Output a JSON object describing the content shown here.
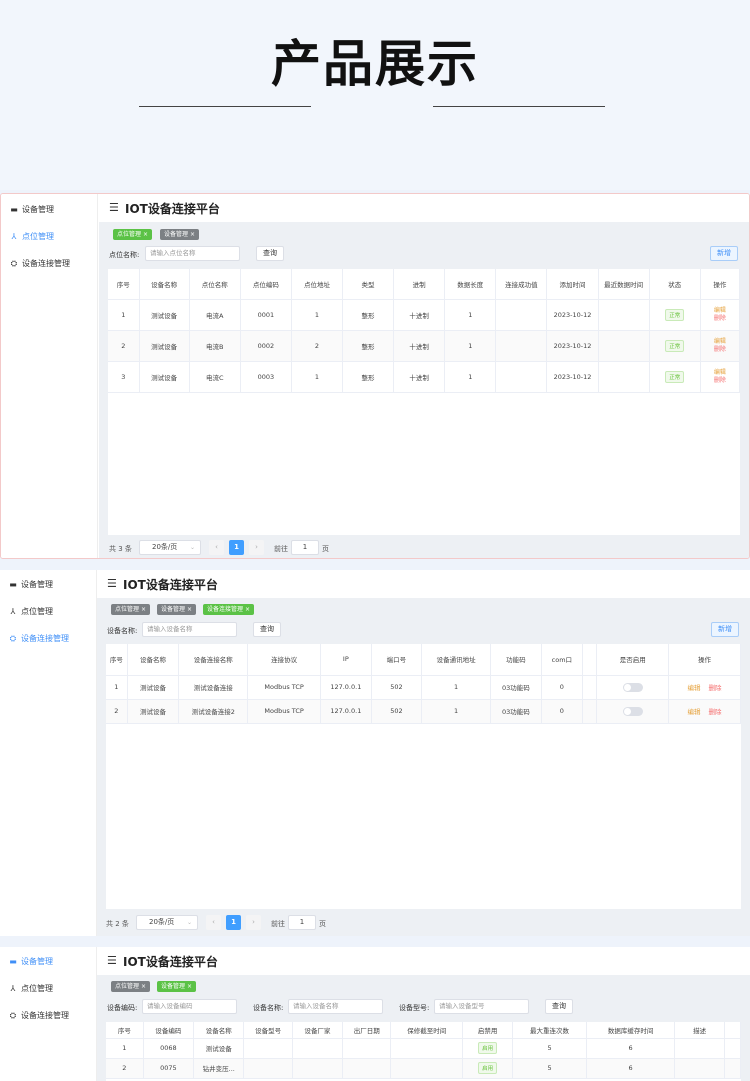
{
  "hero": {
    "title": "产品展示"
  },
  "app": {
    "title": "IOT设备连接平台"
  },
  "sidebar": {
    "items": [
      "设备管理",
      "点位管理",
      "设备连接管理"
    ]
  },
  "tags": {
    "point": "点位管理",
    "device": "设备管理",
    "connection": "设备连接管理",
    "close": "×"
  },
  "buttons": {
    "query": "查询",
    "add": "新增"
  },
  "pager": {
    "page_size": "20条/页",
    "goto": "前往",
    "page_unit": "页",
    "current_page": "1",
    "prev": "‹",
    "next": "›",
    "size_arrow": "⌄"
  },
  "panel1": {
    "search_label": "点位名称:",
    "search_placeholder": "请输入点位名称",
    "headers": [
      "序号",
      "设备名称",
      "点位名称",
      "点位编码",
      "点位地址",
      "类型",
      "进制",
      "数据长度",
      "连接成功值",
      "添加时间",
      "最近数据时间",
      "状态",
      "操作"
    ],
    "rows": [
      [
        "1",
        "测试设备",
        "电流A",
        "0001",
        "1",
        "整形",
        "十进制",
        "1",
        "",
        "2023-10-12",
        "",
        "正常"
      ],
      [
        "2",
        "测试设备",
        "电流B",
        "0002",
        "2",
        "整形",
        "十进制",
        "1",
        "",
        "2023-10-12",
        "",
        "正常"
      ],
      [
        "3",
        "测试设备",
        "电流C",
        "0003",
        "1",
        "整形",
        "十进制",
        "1",
        "",
        "2023-10-12",
        "",
        "正常"
      ]
    ],
    "edit": "编辑",
    "delete": "删除",
    "total": "共 3 条"
  },
  "panel2": {
    "search_label": "设备名称:",
    "search_placeholder": "请输入设备名称",
    "headers": [
      "序号",
      "设备名称",
      "设备连接名称",
      "连接协议",
      "IP",
      "端口号",
      "设备通讯地址",
      "功能码",
      "com口",
      "",
      "是否启用",
      "操作"
    ],
    "rows": [
      [
        "1",
        "测试设备",
        "测试设备连接",
        "Modbus TCP",
        "127.0.0.1",
        "502",
        "1",
        "03功能码",
        "0",
        ""
      ],
      [
        "2",
        "测试设备",
        "测试设备连接2",
        "Modbus TCP",
        "127.0.0.1",
        "502",
        "1",
        "03功能码",
        "0",
        ""
      ]
    ],
    "edit": "编辑",
    "delete": "删除",
    "total": "共 2 条"
  },
  "panel3": {
    "search": [
      {
        "label": "设备编码:",
        "placeholder": "请输入设备编码"
      },
      {
        "label": "设备名称:",
        "placeholder": "请输入设备名称"
      },
      {
        "label": "设备型号:",
        "placeholder": "请输入设备型号"
      }
    ],
    "headers": [
      "序号",
      "设备编码",
      "设备名称",
      "设备型号",
      "设备厂家",
      "出厂日期",
      "保修截至时间",
      "启禁用",
      "最大重连次数",
      "数据库缓存时间",
      "描述"
    ],
    "rows": [
      [
        "1",
        "0068",
        "测试设备",
        "",
        "",
        "",
        "",
        "启用",
        "5",
        "6",
        ""
      ],
      [
        "2",
        "0075",
        "钻井变压...",
        "",
        "",
        "",
        "",
        "启用",
        "5",
        "6",
        ""
      ]
    ]
  },
  "colors": {
    "accent": "#409eff",
    "green": "#5bc246",
    "grey_tag": "#7c8084",
    "edit": "#e6a23c",
    "delete": "#f56c6c"
  }
}
